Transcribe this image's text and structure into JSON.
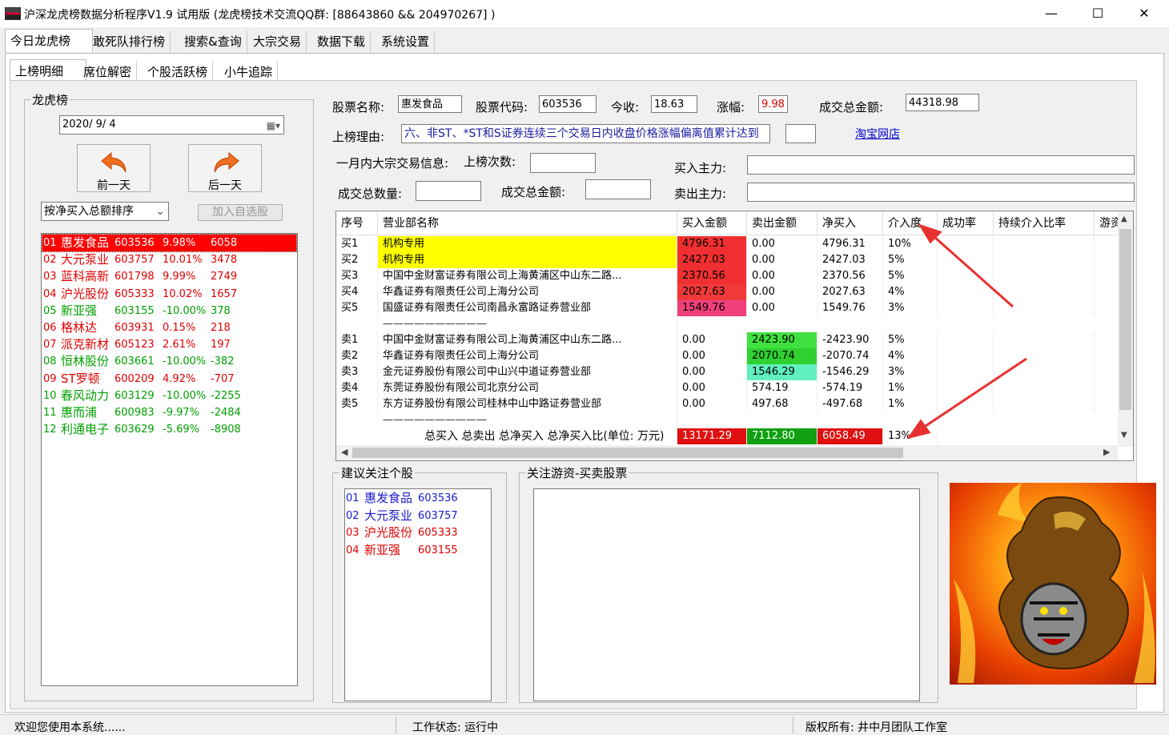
{
  "window": {
    "title": "沪深龙虎榜数据分析程序V1.9  试用版 (龙虎榜技术交流QQ群: [88643860 && 204970267]  )",
    "minimize": "—",
    "maximize": "☐",
    "close": "✕"
  },
  "main_tabs": [
    "今日龙虎榜",
    "敢死队排行榜",
    "搜索&查询",
    "大宗交易",
    "数据下载",
    "系统设置"
  ],
  "sub_tabs": [
    "上榜明细",
    "席位解密",
    "个股活跃榜",
    "小牛追踪"
  ],
  "left": {
    "group_label": "龙虎榜",
    "date_value": "2020/  9/  4",
    "prev_label": "前一天",
    "next_label": "后一天",
    "sort_value": "按净买入总额排序",
    "add_watch_label": "加入自选股",
    "stocks": [
      {
        "no": "01",
        "name": "惠发食品",
        "code": "603536",
        "pct": "9.98%",
        "net": "6058"
      },
      {
        "no": "02",
        "name": "大元泵业",
        "code": "603757",
        "pct": "10.01%",
        "net": "3478"
      },
      {
        "no": "03",
        "name": "蓝科高新",
        "code": "601798",
        "pct": "9.99%",
        "net": "2749"
      },
      {
        "no": "04",
        "name": "沪光股份",
        "code": "605333",
        "pct": "10.02%",
        "net": "1657"
      },
      {
        "no": "05",
        "name": "新亚强",
        "code": "603155",
        "pct": "-10.00%",
        "net": "378"
      },
      {
        "no": "06",
        "name": "格林达",
        "code": "603931",
        "pct": "0.15%",
        "net": "218"
      },
      {
        "no": "07",
        "name": "派克新材",
        "code": "605123",
        "pct": "2.61%",
        "net": "197"
      },
      {
        "no": "08",
        "name": "恒林股份",
        "code": "603661",
        "pct": "-10.00%",
        "net": "-382"
      },
      {
        "no": "09",
        "name": "ST罗顿",
        "code": "600209",
        "pct": "4.92%",
        "net": "-707"
      },
      {
        "no": "10",
        "name": "春风动力",
        "code": "603129",
        "pct": "-10.00%",
        "net": "-2255"
      },
      {
        "no": "11",
        "name": "惠而浦",
        "code": "600983",
        "pct": "-9.97%",
        "net": "-2484"
      },
      {
        "no": "12",
        "name": "利通电子",
        "code": "603629",
        "pct": "-5.69%",
        "net": "-8908"
      }
    ]
  },
  "info": {
    "name_label": "股票名称:",
    "name_value": "惠发食品",
    "code_label": "股票代码:",
    "code_value": "603536",
    "close_label": "今收:",
    "close_value": "18.63",
    "change_label": "涨幅:",
    "change_value": "9.98",
    "amount_label": "成交总金额:",
    "amount_value": "44318.98",
    "reason_label": "上榜理由:",
    "reason_value": "六、非ST、*ST和S证券连续三个交易日内收盘价格涨幅偏离值累计达到",
    "shop_link": "淘宝网店",
    "block_label": "一月内大宗交易信息:",
    "times_label": "上榜次数:",
    "buy_main_label": "买入主力:",
    "vol_label": "成交总数量:",
    "block_amount_label": "成交总金额:",
    "sell_main_label": "卖出主力:"
  },
  "table": {
    "headers": [
      "序号",
      "营业部名称",
      "买入金额",
      "卖出金额",
      "净买入",
      "介入度",
      "成功率",
      "持续介入比率",
      "游资"
    ],
    "buys": [
      {
        "no": "买1",
        "name": "机构专用",
        "buy": "4796.31",
        "sell": "0.00",
        "net": "4796.31",
        "pct": "10%"
      },
      {
        "no": "买2",
        "name": "机构专用",
        "buy": "2427.03",
        "sell": "0.00",
        "net": "2427.03",
        "pct": "5%"
      },
      {
        "no": "买3",
        "name": "中国中金财富证券有限公司上海黄浦区中山东二路...",
        "buy": "2370.56",
        "sell": "0.00",
        "net": "2370.56",
        "pct": "5%"
      },
      {
        "no": "买4",
        "name": "华鑫证券有限责任公司上海分公司",
        "buy": "2027.63",
        "sell": "0.00",
        "net": "2027.63",
        "pct": "4%"
      },
      {
        "no": "买5",
        "name": "国盛证券有限责任公司南昌永富路证券营业部",
        "buy": "1549.76",
        "sell": "0.00",
        "net": "1549.76",
        "pct": "3%"
      }
    ],
    "sells": [
      {
        "no": "卖1",
        "name": "中国中金财富证券有限公司上海黄浦区中山东二路...",
        "buy": "0.00",
        "sell": "2423.90",
        "net": "-2423.90",
        "pct": "5%"
      },
      {
        "no": "卖2",
        "name": "华鑫证券有限责任公司上海分公司",
        "buy": "0.00",
        "sell": "2070.74",
        "net": "-2070.74",
        "pct": "4%"
      },
      {
        "no": "卖3",
        "name": "金元证券股份有限公司中山兴中道证券营业部",
        "buy": "0.00",
        "sell": "1546.29",
        "net": "-1546.29",
        "pct": "3%"
      },
      {
        "no": "卖4",
        "name": "东莞证券股份有限公司北京分公司",
        "buy": "0.00",
        "sell": "574.19",
        "net": "-574.19",
        "pct": "1%"
      },
      {
        "no": "卖5",
        "name": "东方证券股份有限公司桂林中山中路证券营业部",
        "buy": "0.00",
        "sell": "497.68",
        "net": "-497.68",
        "pct": "1%"
      }
    ],
    "total_label": "总买入   总卖出   总净买入   总净买入比(单位: 万元)",
    "total_buy": "13171.29",
    "total_sell": "7112.80",
    "total_net": "6058.49",
    "total_pct": "13%",
    "dash_line": "——————————"
  },
  "suggest": {
    "label": "建议关注个股",
    "items": [
      {
        "no": "01",
        "name": "惠发食品",
        "code": "603536"
      },
      {
        "no": "02",
        "name": "大元泵业",
        "code": "603757"
      },
      {
        "no": "03",
        "name": "沪光股份",
        "code": "605333"
      },
      {
        "no": "04",
        "name": "新亚强",
        "code": "603155"
      }
    ]
  },
  "follow": {
    "label": "关注游资-买卖股票"
  },
  "status": {
    "welcome": "欢迎您使用本系统......",
    "state": "工作状态: 运行中",
    "copyright": "版权所有: 井中月团队工作室"
  },
  "colors": {
    "up": "#e00000",
    "down": "#00a000",
    "selected": "#ff0000",
    "yellow": "#ffff00",
    "buy_red": "#ff2020",
    "sell_green": "#22dd22",
    "accent": "#0000cc"
  },
  "icons": {
    "prev": "arrow-left-icon",
    "next": "arrow-right-icon",
    "calendar": "calendar-icon"
  }
}
